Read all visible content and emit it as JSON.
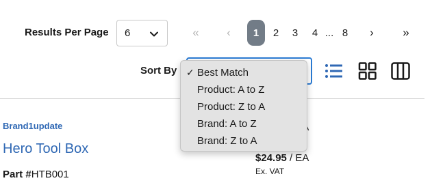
{
  "toolbar": {
    "results_per_page_label": "Results Per Page",
    "results_per_page_value": "6",
    "sort_by_label": "Sort By"
  },
  "pagination": {
    "first": "«",
    "prev": "‹",
    "pages": [
      "1",
      "2",
      "3",
      "4"
    ],
    "ellipsis": "...",
    "last_page": "8",
    "next": "›",
    "last": "»",
    "current_page": "1"
  },
  "sort_menu": {
    "options": [
      {
        "label": "Best Match",
        "selected": true,
        "check": "✓"
      },
      {
        "label": "Product: A to Z",
        "selected": false
      },
      {
        "label": "Product: Z to A",
        "selected": false
      },
      {
        "label": "Brand: A to Z",
        "selected": false
      },
      {
        "label": "Brand: Z to A",
        "selected": false
      }
    ]
  },
  "view_icons": [
    "list-view-icon",
    "grid-view-icon",
    "columns-view-icon"
  ],
  "product": {
    "brand": "Brand1update",
    "title": "Hero Tool Box",
    "part_label": "Part #",
    "part_number": "HTB001",
    "partial_text_1": "A",
    "partial_text_2": ")",
    "price": "$24.95",
    "unit": " / EA",
    "vat_note": "Ex. VAT"
  },
  "colors": {
    "accent": "#2a7bd4",
    "link": "#2f68b4",
    "current_page_bg": "#727c87",
    "icon_blue": "#2f68b4",
    "menu_bg": "#e3e3e3"
  }
}
